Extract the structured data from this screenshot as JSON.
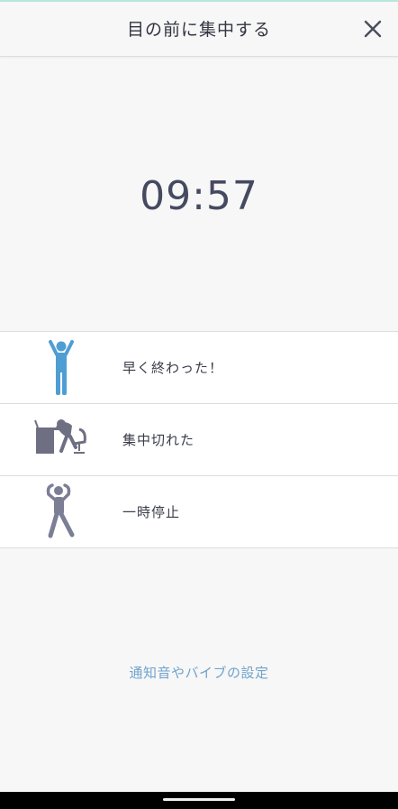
{
  "header": {
    "title": "目の前に集中する",
    "close_icon": "close-icon"
  },
  "timer": {
    "value": "09:57"
  },
  "actions": [
    {
      "label": "早く終わった！",
      "icon": "cheering-person-icon",
      "icon_color": "#4f9ed3"
    },
    {
      "label": "集中切れた",
      "icon": "exhausted-person-at-desk-icon",
      "icon_color": "#6e6f82"
    },
    {
      "label": "一時停止",
      "icon": "stretching-person-icon",
      "icon_color": "#7c7e96"
    }
  ],
  "footer": {
    "settings_link": "通知音やバイブの設定"
  },
  "colors": {
    "background": "#f7f7f7",
    "text": "#3a3d4a",
    "link": "#6fa3cc",
    "accent_blue": "#4f9ed3"
  }
}
